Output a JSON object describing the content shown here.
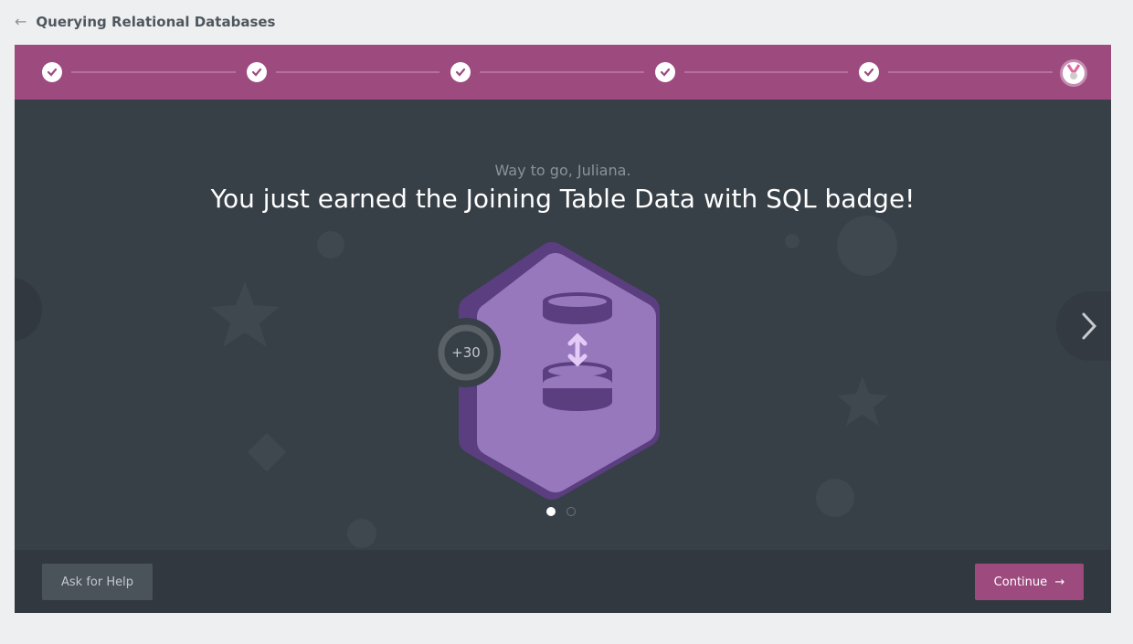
{
  "header": {
    "back_icon": "arrow-left-icon",
    "course_title": "Querying Relational Databases"
  },
  "progress": {
    "completed_steps": 5,
    "total_steps": 6,
    "final_icon": "badge-medal-icon",
    "accent": "#9d4b7f"
  },
  "celebration": {
    "greeting": "Way to go, Juliana.",
    "headline": "You just earned the Joining Table Data with SQL badge!",
    "points": "+30",
    "badge_icon": "database-join-icon"
  },
  "carousel": {
    "pages": 2,
    "active": 1,
    "next_icon": "chevron-right-icon"
  },
  "footer": {
    "help_label": "Ask for Help",
    "continue_label": "Continue",
    "continue_icon": "arrow-right-icon"
  }
}
